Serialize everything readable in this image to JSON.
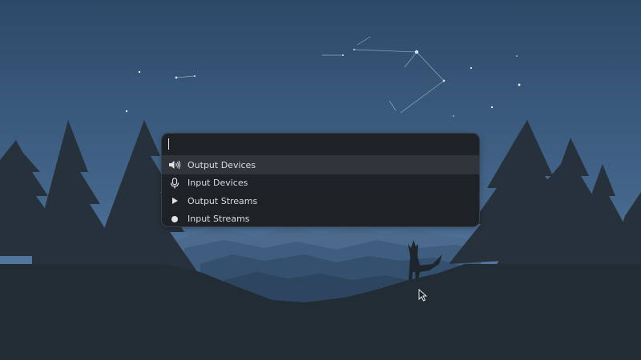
{
  "search": {
    "value": "",
    "placeholder": ""
  },
  "results": [
    {
      "label": "Output Devices",
      "icon": "speaker-icon",
      "selected": true
    },
    {
      "label": "Input Devices",
      "icon": "microphone-icon",
      "selected": false
    },
    {
      "label": "Output Streams",
      "icon": "play-icon",
      "selected": false
    },
    {
      "label": "Input Streams",
      "icon": "record-icon",
      "selected": false
    }
  ],
  "colors": {
    "panel_background": "#1e2227",
    "selected_row": "#30353c",
    "text": "#d9dcdf",
    "sky_top": "#2d4a6b",
    "sky_bottom": "#4a6d94",
    "foreground_silhouette": "#222c35"
  }
}
